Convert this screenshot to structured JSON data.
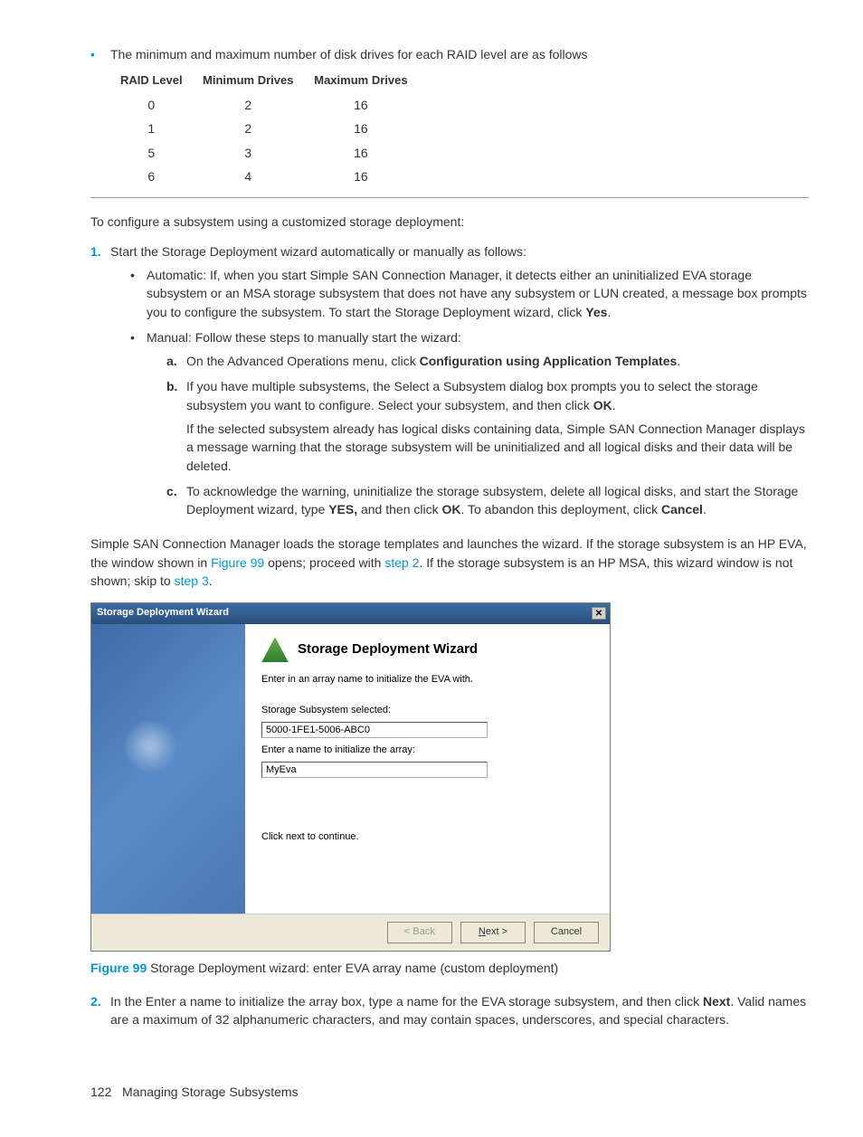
{
  "top_bullet": "The minimum and maximum number of disk drives for each RAID level are as follows",
  "raid_table": {
    "headers": [
      "RAID Level",
      "Minimum Drives",
      "Maximum Drives"
    ],
    "rows": [
      [
        "0",
        "2",
        "16"
      ],
      [
        "1",
        "2",
        "16"
      ],
      [
        "5",
        "3",
        "16"
      ],
      [
        "6",
        "4",
        "16"
      ]
    ]
  },
  "intro": "To configure a subsystem using a customized storage deployment:",
  "step1": {
    "num": "1.",
    "text": "Start the Storage Deployment wizard automatically or manually as follows:",
    "auto_prefix": "Automatic: If, when you start Simple SAN Connection Manager, it detects either an uninitialized EVA storage subsystem or an MSA storage subsystem that does not have any subsystem or LUN created, a message box prompts you to configure the subsystem. To start the Storage Deployment wizard, click ",
    "auto_bold": "Yes",
    "auto_suffix": ".",
    "manual_intro": "Manual: Follow these steps to manually start the wizard:",
    "a": {
      "letter": "a.",
      "t1": "On the Advanced Operations menu, click ",
      "b1": "Configuration using Application Templates",
      "t2": "."
    },
    "b": {
      "letter": "b.",
      "t1": "If you have multiple subsystems, the Select a Subsystem dialog box prompts you to select the storage subsystem you want to configure. Select your subsystem, and then click ",
      "b1": "OK",
      "t2": ".",
      "extra": "If the selected subsystem already has logical disks containing data, Simple SAN Connection Manager displays a message warning that the storage subsystem will be uninitialized and all logical disks and their data will be deleted."
    },
    "c": {
      "letter": "c.",
      "t1": "To acknowledge the warning, uninitialize the storage subsystem, delete all logical disks, and start the Storage Deployment wizard, type ",
      "b1": "YES,",
      "t2": " and then click ",
      "b2": "OK",
      "t3": ". To abandon this deployment, click ",
      "b3": "Cancel",
      "t4": "."
    }
  },
  "after": {
    "t1": "Simple SAN Connection Manager loads the storage templates and launches the wizard. If the storage subsystem is an HP EVA, the window shown in ",
    "l1": "Figure 99",
    "t2": " opens; proceed with ",
    "l2": "step 2",
    "t3": ". If the storage subsystem is an HP MSA, this wizard window is not shown; skip to ",
    "l3": "step 3",
    "t4": "."
  },
  "wizard": {
    "title": "Storage Deployment Wizard",
    "heading": "Storage Deployment Wizard",
    "prompt": "Enter in an array name to initialize the EVA with.",
    "label1": "Storage Subsystem selected:",
    "value1": "5000-1FE1-5006-ABC0",
    "label2": "Enter a name to initialize the array:",
    "value2": "MyEva",
    "hint": "Click next to continue.",
    "back": "< Back",
    "next_u": "N",
    "next_rest": "ext >",
    "cancel": "Cancel"
  },
  "fig": {
    "label": "Figure 99",
    "text": " Storage Deployment wizard: enter EVA array name (custom deployment)"
  },
  "step2": {
    "num": "2.",
    "t1": "In the Enter a name to initialize the array box, type a name for the EVA storage subsystem, and then click ",
    "b1": "Next",
    "t2": ". Valid names are a maximum of 32 alphanumeric characters, and may contain spaces, underscores, and special characters."
  },
  "footer": {
    "page": "122",
    "section": "Managing Storage Subsystems"
  }
}
